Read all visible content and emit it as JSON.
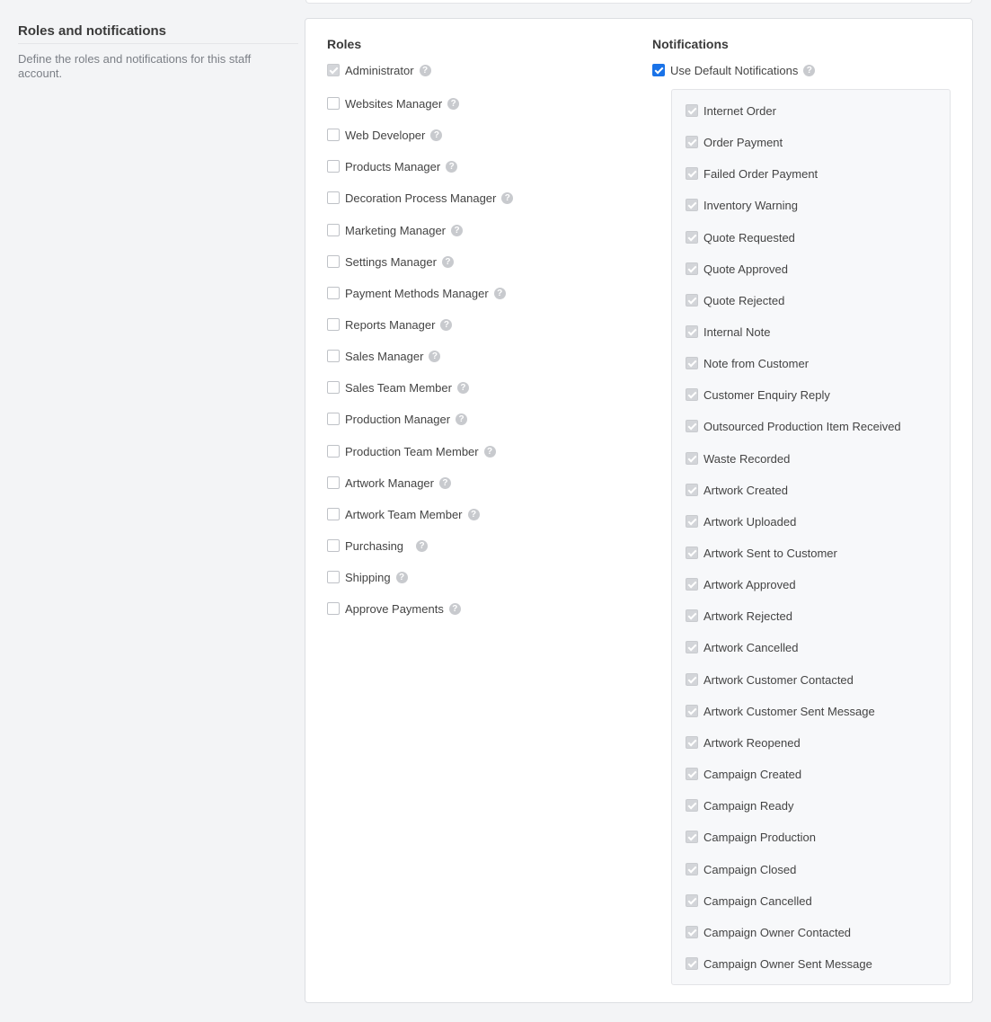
{
  "section": {
    "title": "Roles and notifications",
    "description": "Define the roles and notifications for this staff account."
  },
  "roles": {
    "title": "Roles",
    "items": [
      {
        "label": "Administrator",
        "checked": true,
        "disabled": true
      },
      {
        "label": "Websites Manager",
        "checked": false
      },
      {
        "label": "Web Developer",
        "checked": false
      },
      {
        "label": "Products Manager",
        "checked": false
      },
      {
        "label": "Decoration Process Manager",
        "checked": false
      },
      {
        "label": "Marketing Manager",
        "checked": false
      },
      {
        "label": "Settings Manager",
        "checked": false
      },
      {
        "label": "Payment Methods Manager",
        "checked": false
      },
      {
        "label": "Reports Manager",
        "checked": false
      },
      {
        "label": "Sales Manager",
        "checked": false
      },
      {
        "label": "Sales Team Member",
        "checked": false
      },
      {
        "label": "Production Manager",
        "checked": false
      },
      {
        "label": "Production Team Member",
        "checked": false
      },
      {
        "label": "Artwork Manager",
        "checked": false
      },
      {
        "label": "Artwork Team Member",
        "checked": false
      },
      {
        "label": "Purchasing",
        "checked": false
      },
      {
        "label": "Shipping",
        "checked": false
      },
      {
        "label": "Approve Payments",
        "checked": false
      }
    ]
  },
  "notifications": {
    "title": "Notifications",
    "use_default_label": "Use Default Notifications",
    "use_default_checked": true,
    "items": [
      "Internet Order",
      "Order Payment",
      "Failed Order Payment",
      "Inventory Warning",
      "Quote Requested",
      "Quote Approved",
      "Quote Rejected",
      "Internal Note",
      "Note from Customer",
      "Customer Enquiry Reply",
      "Outsourced Production Item Received",
      "Waste Recorded",
      "Artwork Created",
      "Artwork Uploaded",
      "Artwork Sent to Customer",
      "Artwork Approved",
      "Artwork Rejected",
      "Artwork Cancelled",
      "Artwork Customer Contacted",
      "Artwork Customer Sent Message",
      "Artwork Reopened",
      "Campaign Created",
      "Campaign Ready",
      "Campaign Production",
      "Campaign Closed",
      "Campaign Cancelled",
      "Campaign Owner Contacted",
      "Campaign Owner Sent Message"
    ]
  },
  "help_glyph": "?",
  "colors": {
    "accent": "#1a73e8",
    "page_bg": "#f3f4f6"
  }
}
